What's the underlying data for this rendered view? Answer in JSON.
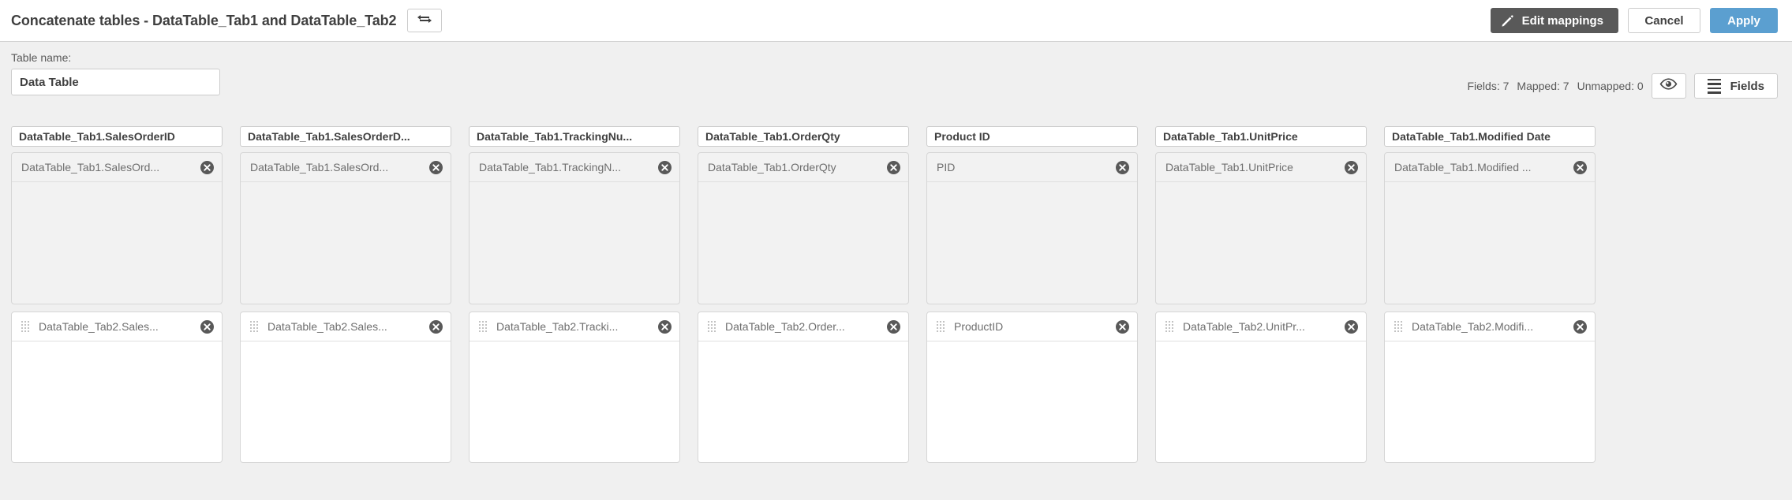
{
  "header": {
    "title": "Concatenate tables - DataTable_Tab1 and DataTable_Tab2",
    "swap_icon": "swap-arrows-icon",
    "edit_mappings_label": "Edit mappings",
    "edit_mappings_icon": "pencil-icon",
    "cancel_label": "Cancel",
    "apply_label": "Apply",
    "accent_color": "#5b9fd0",
    "dark_button_color": "#595959"
  },
  "table_name": {
    "label": "Table name:",
    "value": "Data Table",
    "placeholder": "Table name"
  },
  "stats": {
    "fields": "Fields: 7",
    "mapped": "Mapped: 7",
    "unmapped": "Unmapped: 0",
    "preview_icon": "eye-icon",
    "fields_button_label": "Fields",
    "fields_button_icon": "hamburger-icon"
  },
  "columns": [
    {
      "header": "DataTable_Tab1.SalesOrderID",
      "row1_chip": "DataTable_Tab1.SalesOrd...",
      "row2_chip": "DataTable_Tab2.Sales..."
    },
    {
      "header": "DataTable_Tab1.SalesOrderD...",
      "row1_chip": "DataTable_Tab1.SalesOrd...",
      "row2_chip": "DataTable_Tab2.Sales..."
    },
    {
      "header": "DataTable_Tab1.TrackingNu...",
      "row1_chip": "DataTable_Tab1.TrackingN...",
      "row2_chip": "DataTable_Tab2.Tracki..."
    },
    {
      "header": "DataTable_Tab1.OrderQty",
      "row1_chip": "DataTable_Tab1.OrderQty",
      "row2_chip": "DataTable_Tab2.Order..."
    },
    {
      "header": "Product ID",
      "row1_chip": "PID",
      "row2_chip": "ProductID"
    },
    {
      "header": "DataTable_Tab1.UnitPrice",
      "row1_chip": "DataTable_Tab1.UnitPrice",
      "row2_chip": "DataTable_Tab2.UnitPr..."
    },
    {
      "header": "DataTable_Tab1.Modified Date",
      "row1_chip": "DataTable_Tab1.Modified ...",
      "row2_chip": "DataTable_Tab2.Modifi..."
    }
  ]
}
